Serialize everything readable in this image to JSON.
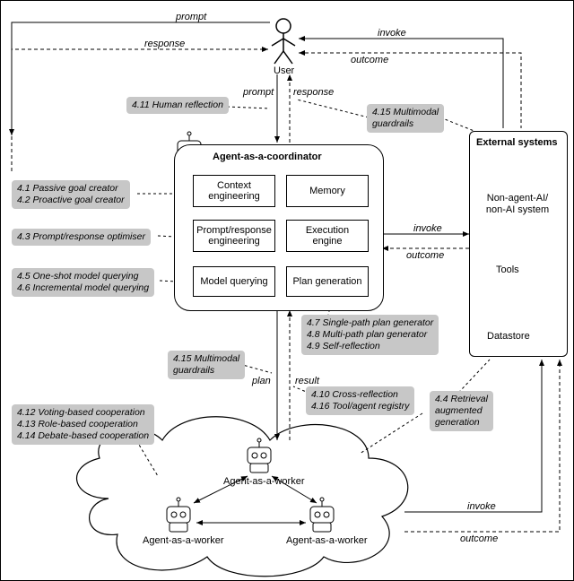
{
  "user": {
    "label": "User"
  },
  "edges": {
    "prompt_top": "prompt",
    "response_top": "response",
    "invoke_top": "invoke",
    "outcome_top": "outcome",
    "prompt_mid": "prompt",
    "response_mid": "response",
    "invoke_ee": "invoke",
    "outcome_ee": "outcome",
    "plan": "plan",
    "result": "result",
    "invoke_bottom": "invoke",
    "outcome_bottom": "outcome"
  },
  "tags": {
    "human_reflection": "4.11 Human reflection",
    "mm_guardrails_top": "4.15 Multimodal\nguardrails",
    "passive_goal": "4.1 Passive goal creator",
    "proactive_goal": "4.2 Proactive goal creator",
    "optimiser": "4.3 Prompt/response optimiser",
    "one_shot": "4.5 One-shot model querying",
    "incremental": "4.6 Incremental model querying",
    "single_path": "4.7 Single-path plan generator",
    "multi_path": "4.8 Multi-path plan generator",
    "self_reflection": "4.9 Self-reflection",
    "mm_guardrails_mid": "4.15 Multimodal\nguardrails",
    "cross_reflection": "4.10 Cross-reflection",
    "tool_registry": "4.16 Tool/agent registry",
    "rag": "4.4 Retrieval\naugmented\ngeneration",
    "voting": "4.12 Voting-based cooperation",
    "role": "4.13 Role-based cooperation",
    "debate": "4.14 Debate-based cooperation"
  },
  "coordinator": {
    "title": "Agent-as-a-coordinator",
    "boxes": {
      "context": "Context\nengineering",
      "memory": "Memory",
      "pre": "Prompt/response\nengineering",
      "exec": "Execution engine",
      "model_q": "Model querying",
      "plan_gen": "Plan generation"
    }
  },
  "external": {
    "title": "External systems",
    "nonagent": "Non-agent-AI/\nnon-AI system",
    "tools": "Tools",
    "datastore": "Datastore"
  },
  "workers": {
    "label": "Agent-as-a-worker"
  }
}
